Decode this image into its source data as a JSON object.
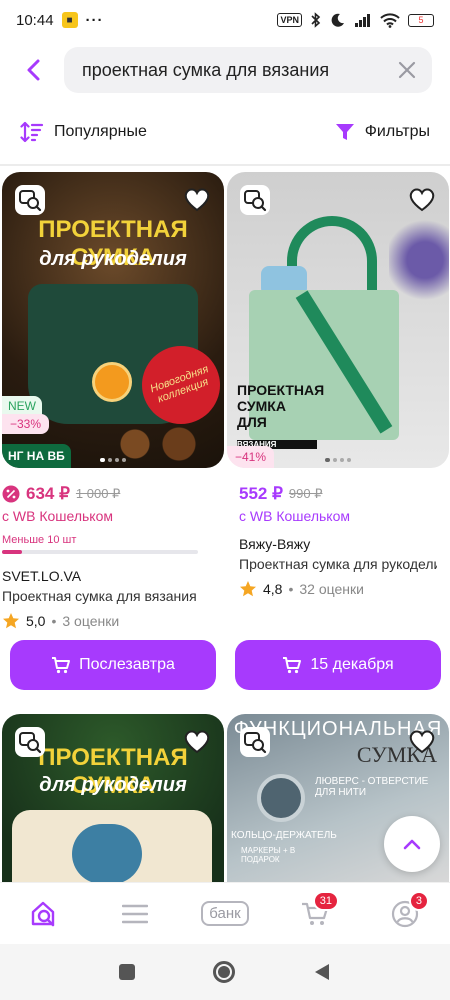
{
  "status": {
    "time": "10:44",
    "dots": "···",
    "vpn": "VPN",
    "battery": "5"
  },
  "search": {
    "query": "проектная сумка для вязания"
  },
  "toolbar": {
    "sort_label": "Популярные",
    "filter_label": "Фильтры"
  },
  "products": [
    {
      "image_headline": "ПРОЕКТНАЯ СУМКА",
      "image_subline": "для рукоделия",
      "image_ornament": "Новогодняя коллекция",
      "badge_new": "NEW",
      "badge_discount": "−33%",
      "badge_promo": "НГ НА ВБ",
      "price": "634 ₽",
      "old_price": "1 000 ₽",
      "wallet": "с WB Кошельком",
      "stock": "Меньше 10 шт",
      "stock_level": 0.1,
      "brand": "SVET.LO.VA",
      "title": "Проектная сумка для вязания",
      "rating": "5,0",
      "reviews": "3 оценки",
      "buy_label": "Послезавтра"
    },
    {
      "image_headline": "ПРОЕКТНАЯ СУМКА ДЛЯ",
      "image_subline": "ВЯЗАНИЯ",
      "badge_discount": "−41%",
      "price": "552 ₽",
      "old_price": "990 ₽",
      "wallet": "с WB Кошельком",
      "brand": "Вяжу-Вяжу",
      "title": "Проектная сумка для рукоделия",
      "rating": "4,8",
      "reviews": "32 оценки",
      "buy_label": "15 декабря"
    },
    {
      "image_headline": "ПРОЕКТНАЯ СУМКА",
      "image_subline": "для рукоделия"
    },
    {
      "image_headline": "ФУНКЦИОНАЛЬНАЯ",
      "image_subline": "СУМКА",
      "image_note1": "ЛЮВЕРС - ОТВЕРСТИЕ ДЛЯ НИТИ",
      "image_note2": "КОЛЬЦО-ДЕРЖАТЕЛЬ",
      "image_note3": "МАРКЕРЫ + В ПОДАРОК"
    }
  ],
  "nav": {
    "bank_label": "банк",
    "cart_badge": "31",
    "profile_badge": "3"
  },
  "colors": {
    "accent": "#a73afd",
    "sale": "#d8347e",
    "star": "#f5a623"
  }
}
